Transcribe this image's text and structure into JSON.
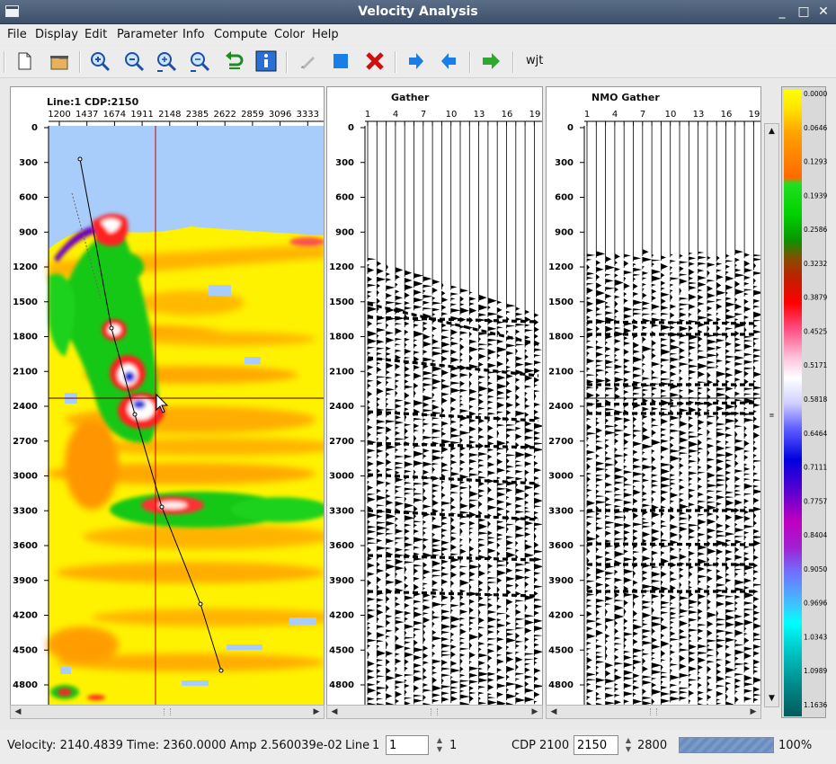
{
  "window": {
    "title": "Velocity Analysis",
    "minimize": "_",
    "maximize": "□",
    "close": "✕"
  },
  "menu": [
    "File",
    "Display",
    "Edit",
    "Parameter",
    "Info",
    "Compute",
    "Color",
    "Help"
  ],
  "toolbar": {
    "user_label": "wjt",
    "icons": [
      "new-file-icon",
      "open-folder-icon",
      "zoom-in-icon",
      "zoom-out-icon",
      "zoom-fit-icon",
      "zoom-reset-icon",
      "undo-icon",
      "info-icon",
      "pick-pen-icon",
      "stop-square-icon",
      "delete-x-icon",
      "next-arrow-icon",
      "prev-arrow-icon",
      "run-arrow-icon"
    ],
    "accent": "#2d7de0"
  },
  "panels": {
    "semblance": {
      "title": "Line:1 CDP:2150",
      "x_ticks": [
        "1200",
        "1437",
        "1674",
        "1911",
        "2148",
        "2385",
        "2622",
        "2859",
        "3096",
        "3333",
        "35"
      ],
      "y_ticks": [
        "0",
        "300",
        "600",
        "900",
        "1200",
        "1500",
        "1800",
        "2100",
        "2400",
        "2700",
        "3000",
        "3300",
        "3600",
        "3900",
        "4200",
        "4500",
        "4800"
      ]
    },
    "gather": {
      "title": "Gather",
      "x_ticks": [
        "1",
        "4",
        "7",
        "10",
        "13",
        "16",
        "19"
      ],
      "y_ticks": [
        "0",
        "300",
        "600",
        "900",
        "1200",
        "1500",
        "1800",
        "2100",
        "2400",
        "2700",
        "3000",
        "3300",
        "3600",
        "3900",
        "4200",
        "4500",
        "4800"
      ]
    },
    "nmo": {
      "title": "NMO Gather",
      "x_ticks": [
        "1",
        "4",
        "7",
        "10",
        "13",
        "16",
        "19"
      ],
      "y_ticks": [
        "0",
        "300",
        "600",
        "900",
        "1200",
        "1500",
        "1800",
        "2100",
        "2400",
        "2700",
        "3000",
        "3300",
        "3600",
        "3900",
        "4200",
        "4500",
        "4800"
      ]
    }
  },
  "colorbar": {
    "labels": [
      "0.0000",
      "0.0646",
      "0.1293",
      "0.1939",
      "0.2586",
      "0.3232",
      "0.3879",
      "0.4525",
      "0.5171",
      "0.5818",
      "0.6464",
      "0.7111",
      "0.7757",
      "0.8404",
      "0.9050",
      "0.9696",
      "1.0343",
      "1.0989",
      "1.1636"
    ],
    "colors": [
      "#ffff00",
      "#ffa000",
      "#ff5a00",
      "#00dc00",
      "#0a9a00",
      "#a03c00",
      "#ff0000",
      "#ff6aa0",
      "#ffffff",
      "#c0c0ff",
      "#5050ff",
      "#0000e0",
      "#5a00c8",
      "#b400b4",
      "#8080ff",
      "#00e0ff",
      "#00b4b4",
      "#008080",
      "#006060"
    ]
  },
  "status": {
    "velocity": "Velocity:  2140.4839 Time:  2360.0000 Amp 2.560039e-02",
    "line_label": "Line",
    "line_min": "1",
    "line_value": "1",
    "line_max": "1",
    "cdp_label": "CDP",
    "cdp_min": "2100",
    "cdp_value": "2150",
    "cdp_max": "2800",
    "progress": 100,
    "progress_label": "100%"
  }
}
